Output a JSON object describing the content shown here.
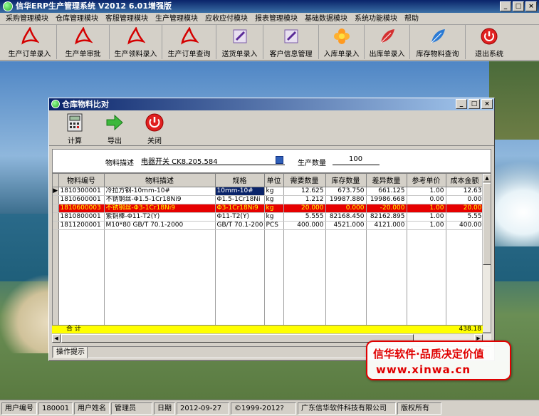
{
  "app": {
    "title": "信华ERP生产管理系统  V2012  6.01增强版"
  },
  "menu": [
    "采购管理模块",
    "仓库管理模块",
    "客服管理模块",
    "生产管理模块",
    "应收应付模块",
    "报表管理模块",
    "基础数据模块",
    "系统功能模块",
    "帮助"
  ],
  "toolbar": [
    {
      "label": "生产订单录入",
      "icon": "pdf-icon"
    },
    {
      "label": "生产单审批",
      "icon": "pdf-icon"
    },
    {
      "label": "生产领料录入",
      "icon": "pdf-icon"
    },
    {
      "label": "生产订单查询",
      "icon": "pdf-icon"
    },
    {
      "label": "送货单录入",
      "icon": "pen-icon"
    },
    {
      "label": "客户信息管理",
      "icon": "pen-icon"
    },
    {
      "label": "入库单录入",
      "icon": "flower-icon"
    },
    {
      "label": "出库单录入",
      "icon": "leaf-icon"
    },
    {
      "label": "库存物料查询",
      "icon": "leaf-icon"
    },
    {
      "label": "退出系统",
      "icon": "power-icon"
    }
  ],
  "subwindow": {
    "title": "仓库物料比对",
    "buttons": [
      {
        "label": "计算",
        "icon": "calculator-icon"
      },
      {
        "label": "导出",
        "icon": "export-arrow-icon"
      },
      {
        "label": "关闭",
        "icon": "power-icon"
      }
    ],
    "filter": {
      "desc_label": "物料描述",
      "desc_value": "电器开关 CK8.205.584",
      "qty_label": "生产数量",
      "qty_value": "100"
    },
    "table": {
      "columns": [
        "物料编号",
        "物料描述",
        "规格",
        "单位",
        "需要数量",
        "库存数量",
        "差异数量",
        "参考单价",
        "成本金额"
      ],
      "rows": [
        {
          "code": "1810300001",
          "desc": "冷拉方钢-10mm-10#",
          "spec": "10mm-10#",
          "unit": "kg",
          "need": "12.625",
          "stock": "673.750",
          "diff": "661.125",
          "price": "1.00",
          "cost": "12.63",
          "style": "current"
        },
        {
          "code": "1810600001",
          "desc": "不锈钢丝-Φ1.5-1Cr18Ni9",
          "spec": "Φ1.5-1Cr18Ni",
          "unit": "kg",
          "need": "1.212",
          "stock": "19987.880",
          "diff": "19986.668",
          "price": "0.00",
          "cost": "0.00",
          "style": "normal"
        },
        {
          "code": "1810600003",
          "desc": "不锈钢丝-Φ3-1Cr18Ni9",
          "spec": "Φ3-1Cr18Ni9",
          "unit": "kg",
          "need": "20.000",
          "stock": "0.000",
          "diff": "-20.000",
          "price": "1.00",
          "cost": "20.00",
          "style": "red"
        },
        {
          "code": "1810800001",
          "desc": "紫铜棒-Φ11-T2(Y)",
          "spec": "Φ11-T2(Y)",
          "unit": "kg",
          "need": "5.555",
          "stock": "82168.450",
          "diff": "82162.895",
          "price": "1.00",
          "cost": "5.55",
          "style": "normal"
        },
        {
          "code": "1811200001",
          "desc": "M10*80 GB/T 70.1-2000",
          "spec": "GB/T 70.1-200",
          "unit": "PCS",
          "need": "400.000",
          "stock": "4521.000",
          "diff": "4121.000",
          "price": "1.00",
          "cost": "400.00",
          "style": "normal"
        }
      ],
      "total_label": "合 计",
      "total_value": "438.18"
    },
    "hint_tab": "操作提示"
  },
  "brand": {
    "line1": "信华软件·品质决定价值",
    "line2": "www.xinwa.cn",
    "color": "#e00000"
  },
  "status": {
    "user_code_label": "用户编号",
    "user_code": "180001",
    "user_name_label": "用户姓名",
    "user_name": "管理员",
    "date_label": "日期",
    "date": "2012-09-27",
    "copyright": "©1999-2012?",
    "company": "广东信华软件科技有限公司",
    "rights": "版权所有"
  }
}
